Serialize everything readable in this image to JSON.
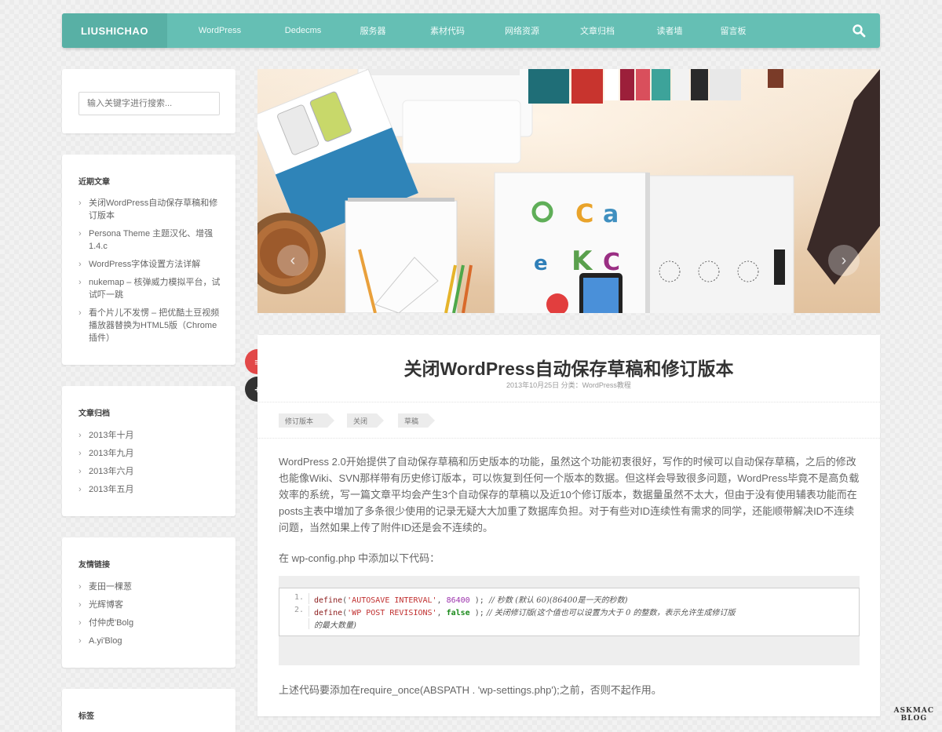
{
  "brand": "LIUSHICHAO",
  "nav": {
    "items": [
      {
        "label": "WordPress"
      },
      {
        "label": "Dedecms"
      },
      {
        "label": "服务器"
      },
      {
        "label": "素材代码"
      },
      {
        "label": "网络资源"
      },
      {
        "label": "文章归档"
      },
      {
        "label": "读者墙"
      },
      {
        "label": "留言板"
      }
    ],
    "search_icon": "search-icon"
  },
  "sidebar": {
    "search_placeholder": "输入关键字进行搜索...",
    "recent": {
      "title": "近期文章",
      "items": [
        "关闭WordPress自动保存草稿和修订版本",
        "Persona Theme 主题汉化、增强 1.4.c",
        "WordPress字体设置方法详解",
        "nukemap – 核弹威力模拟平台，试试吓一跳",
        "看个片儿不发愣 – 把优酷土豆视频播放器替换为HTML5版（Chrome 插件）"
      ]
    },
    "archive": {
      "title": "文章归档",
      "items": [
        "2013年十月",
        "2013年九月",
        "2013年六月",
        "2013年五月"
      ]
    },
    "links": {
      "title": "友情链接",
      "items": [
        "麦田一棵葱",
        "光辉博客",
        "付仲虎'Bolg",
        "A.yi'Blog"
      ]
    },
    "tags": {
      "title": "标签"
    }
  },
  "slider": {
    "prev": "‹",
    "next": "›"
  },
  "post": {
    "title": "关闭WordPress自动保存草稿和修订版本",
    "meta": "2013年10月25日   分类：WordPress教程",
    "tags": [
      "修订版本",
      "关闭",
      "草稿"
    ],
    "body": "WordPress 2.0开始提供了自动保存草稿和历史版本的功能，虽然这个功能初衷很好，写作的时候可以自动保存草稿，之后的修改也能像Wiki、SVN那样带有历史修订版本，可以恢复到任何一个版本的数据。但这样会导致很多问题，WordPress毕竟不是高负载效率的系统，写一篇文章平均会产生3个自动保存的草稿以及近10个修订版本，数据量虽然不太大，但由于没有使用辅表功能而在posts主表中增加了多条很少使用的记录无疑大大加重了数据库负担。对于有些对ID连续性有需求的同学，还能顺带解决ID不连续问题，当然如果上传了附件ID还是会不连续的。",
    "p2": "在 wp-config.php 中添加以下代码：",
    "code": {
      "line1": {
        "num": "1.",
        "kw": "define",
        "open": "(",
        "str": "'AUTOSAVE_INTERVAL'",
        "sep": ", ",
        "val": "86400",
        "close": " );",
        "comment": "  // 秒数 (默认 60)(86400是一天的秒数)"
      },
      "line2": {
        "num": "2.",
        "kw": "define",
        "open": "(",
        "str": "'WP_POST_REVISIONS'",
        "sep": ", ",
        "val": "false",
        "close": " );",
        "comment": " // 关闭修订版(这个值也可以设置为大于 0 的整数，表示允许生成修订版",
        "comment2": "的最大数量)"
      }
    },
    "p3": "上述代码要添加在require_once(ABSPATH . 'wp-settings.php');之前，否则不起作用。"
  },
  "float_buttons": {
    "top": "≡",
    "add": "+"
  },
  "watermark": {
    "line1": "ASKMAC",
    "line2": "BLOG"
  },
  "colors": {
    "accent": "#65bfb4",
    "red_button": "#e24848",
    "dark_button": "#333333"
  }
}
